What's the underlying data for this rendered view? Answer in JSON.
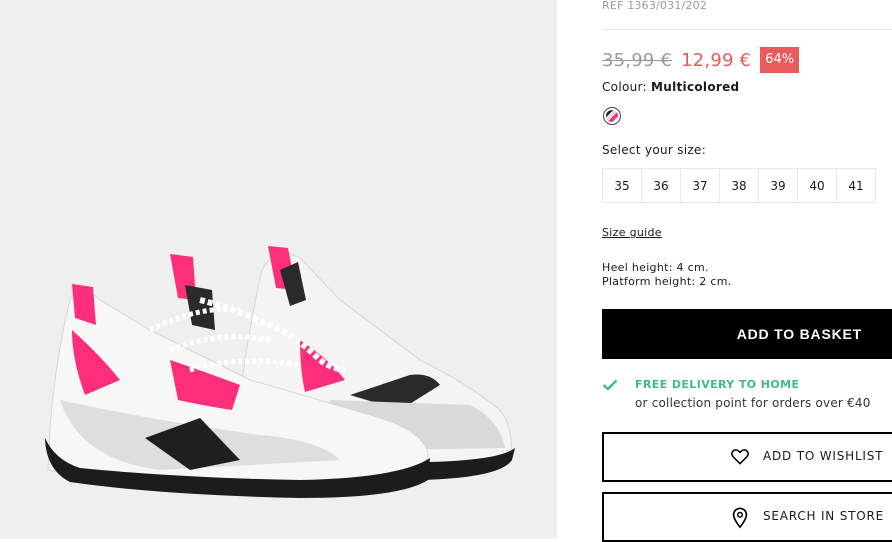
{
  "product": {
    "ref": "REF 1363/031/202",
    "old_price": "35,99 €",
    "new_price": "12,99 €",
    "discount": "64%",
    "colour_label": "Colour:",
    "colour_value": "Multicolored",
    "size_label": "Select your size:",
    "sizes": [
      "35",
      "36",
      "37",
      "38",
      "39",
      "40",
      "41"
    ],
    "size_guide": "Size guide",
    "heel_height": "Heel height: 4 cm.",
    "platform_height": "Platform height: 2 cm."
  },
  "actions": {
    "add_to_basket": "ADD TO BASKET",
    "add_to_wishlist": "ADD TO WISHLIST",
    "search_in_store": "SEARCH IN STORE"
  },
  "delivery": {
    "title": "FREE DELIVERY TO HOME",
    "subtitle": "or collection point for orders over €40"
  },
  "icons": {
    "check": "check-icon",
    "heart": "heart-icon",
    "location": "location-pin-icon"
  },
  "colors": {
    "sale_red": "#ec5b5b",
    "delivery_green": "#3dbb8a",
    "primary_black": "#000000"
  }
}
